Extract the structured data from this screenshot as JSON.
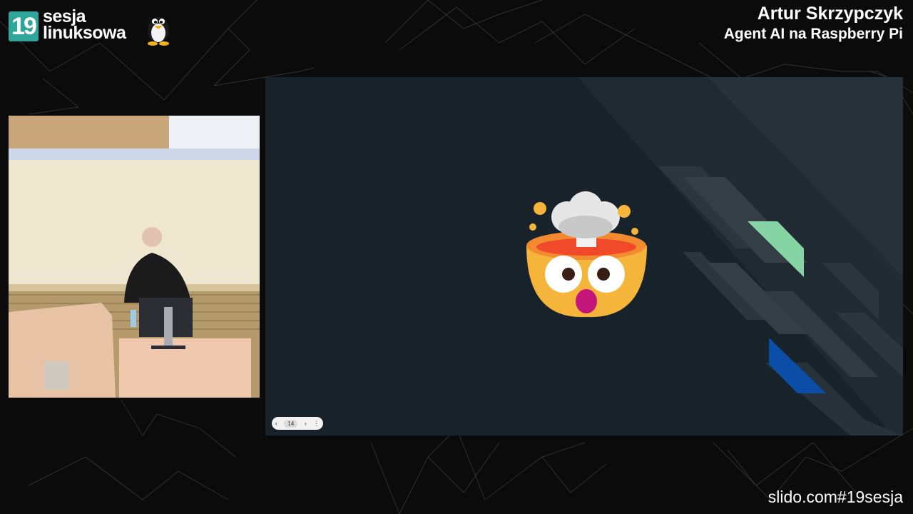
{
  "branding": {
    "logo_number": "19",
    "logo_line1": "sesja",
    "logo_line2": "linuksowa"
  },
  "speaker": {
    "name": "Artur Skrzypczyk",
    "talk_title": "Agent AI na Raspberry Pi"
  },
  "slide": {
    "background": "#18222a",
    "emoji": "exploding-head-icon",
    "controls": {
      "prev_label": "‹",
      "page": "14",
      "next_label": "›",
      "menu_label": "⋮"
    }
  },
  "footer": {
    "url": "slido.com#19sesja"
  },
  "colors": {
    "accent_teal": "#2fa59b",
    "deco_green": "#86d3a4",
    "deco_blue": "#0b4ea8"
  }
}
